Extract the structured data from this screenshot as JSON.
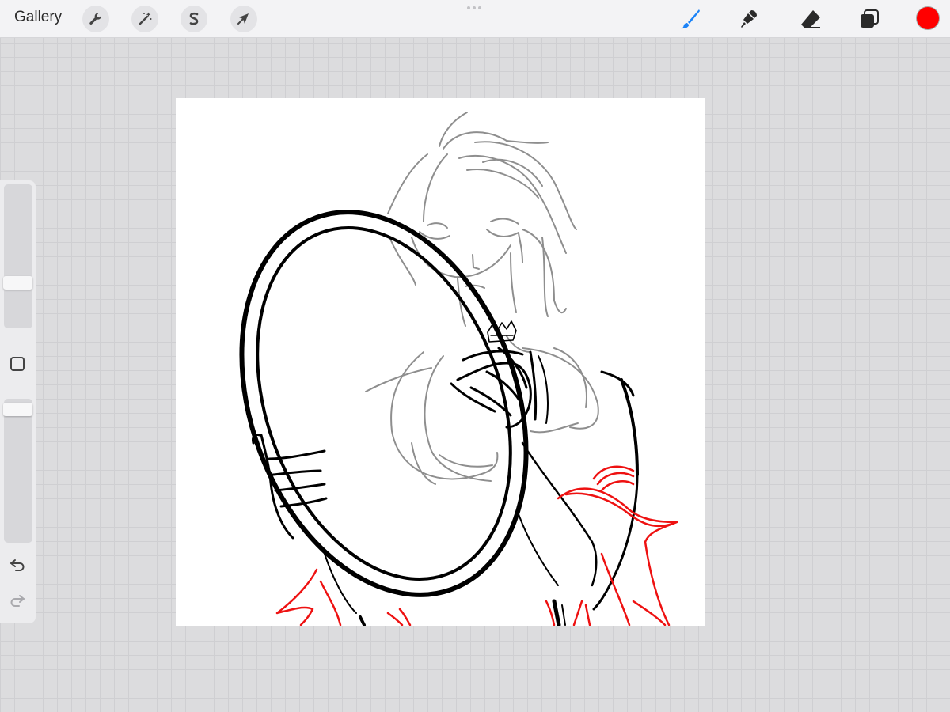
{
  "topbar": {
    "gallery_label": "Gallery",
    "actions": [
      {
        "name": "actions",
        "icon": "wrench-icon"
      },
      {
        "name": "adjustments",
        "icon": "magic-wand-icon"
      },
      {
        "name": "selection",
        "icon": "selection-s-icon"
      },
      {
        "name": "transform",
        "icon": "arrow-cursor-icon"
      }
    ],
    "tools": [
      {
        "name": "brush",
        "icon": "brush-icon",
        "active": true
      },
      {
        "name": "smudge",
        "icon": "smudge-icon",
        "active": false
      },
      {
        "name": "eraser",
        "icon": "eraser-icon",
        "active": false
      },
      {
        "name": "layers",
        "icon": "layers-icon",
        "active": false
      }
    ],
    "current_color": "#ff0000",
    "active_tool_color": "#1a82f7"
  },
  "sidebar": {
    "brush_size_level": 0.3,
    "brush_opacity_level": 0.97,
    "items": [
      "brush-size-slider",
      "modify-button",
      "opacity-slider",
      "undo-icon",
      "redo-icon"
    ]
  },
  "canvas": {
    "background": "#ffffff",
    "layers": [
      "sketch-gray",
      "lineart-black",
      "lineart-red"
    ]
  }
}
